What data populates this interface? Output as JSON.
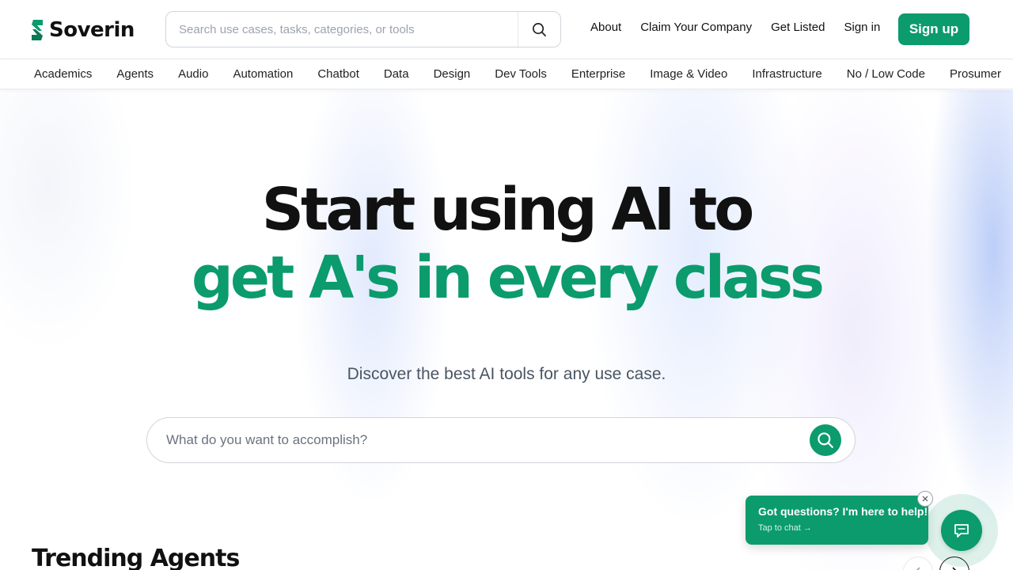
{
  "header": {
    "brand": "Soverin",
    "search": {
      "placeholder": "Search use cases, tasks, categories, or tools",
      "value": ""
    },
    "nav": [
      "About",
      "Claim Your Company",
      "Get Listed",
      "Sign in"
    ],
    "signup_label": "Sign up"
  },
  "categories": [
    "Academics",
    "Agents",
    "Audio",
    "Automation",
    "Chatbot",
    "Data",
    "Design",
    "Dev Tools",
    "Enterprise",
    "Image & Video",
    "Infrastructure",
    "No / Low Code",
    "Prosumer"
  ],
  "hero": {
    "line1": "Start using AI to",
    "line2": "get A's in every class",
    "subtitle": "Discover the best AI tools for any use case.",
    "search": {
      "placeholder": "What do you want to accomplish?",
      "value": ""
    }
  },
  "trending": {
    "title": "Trending Agents"
  },
  "chat": {
    "title": "Got questions? I'm here to help!",
    "subtitle": "Tap to chat →"
  },
  "colors": {
    "accent": "#0b9b6d",
    "text": "#111111",
    "muted": "#4b5563",
    "border": "#e5e7eb"
  },
  "icons": {
    "brand": "soverin-logo-icon",
    "search": "search-icon",
    "chevron_left": "chevron-left-icon",
    "chevron_right": "chevron-right-icon",
    "close": "close-icon",
    "chat": "chat-bubble-icon"
  }
}
